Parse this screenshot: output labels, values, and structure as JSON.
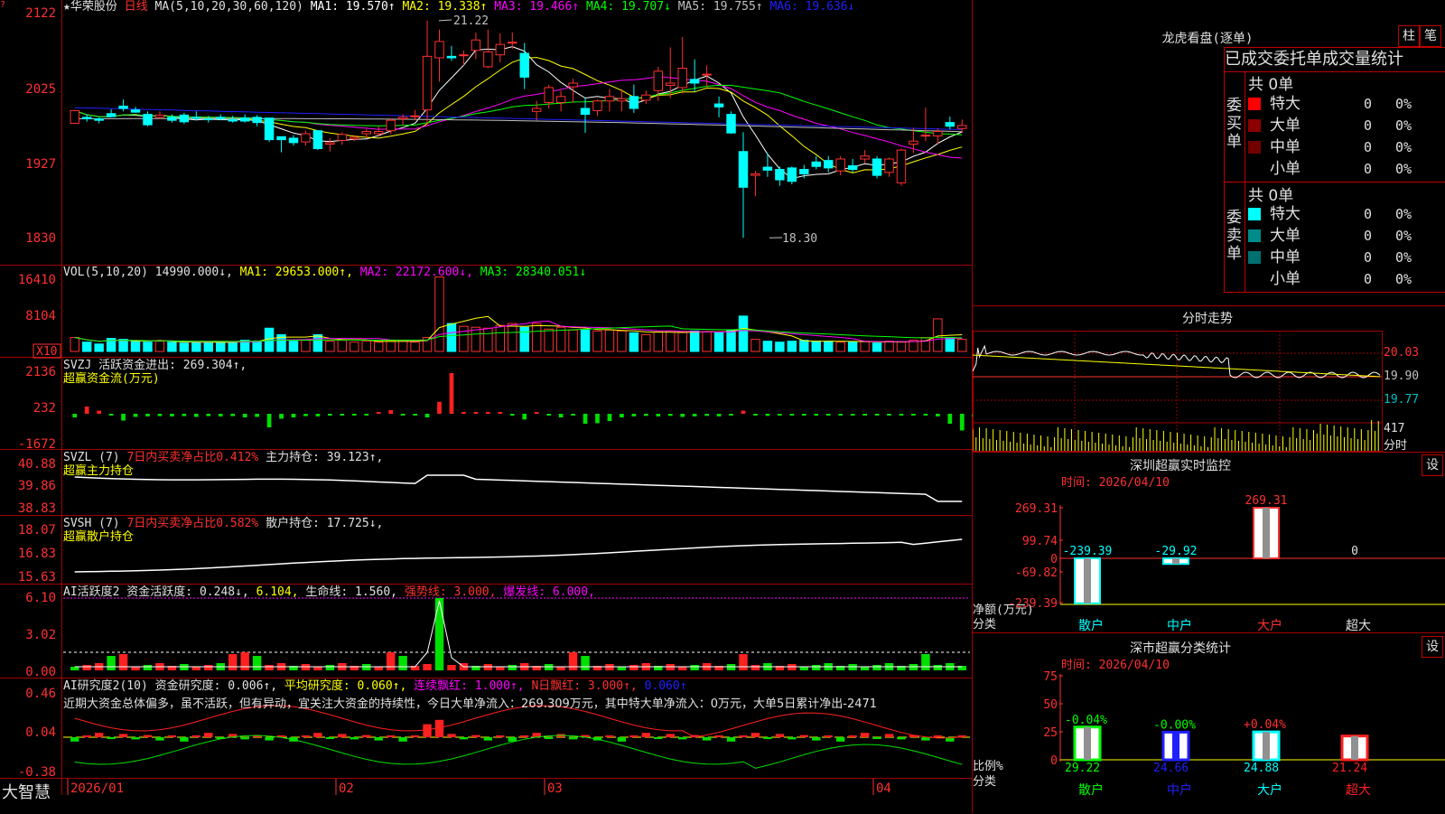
{
  "stock": {
    "name": "华荣股份",
    "period": "日线",
    "star": "★"
  },
  "kline_header": {
    "ma_label": "MA(5,10,20,30,60,120)",
    "ma1": "MA1: 19.570↑",
    "ma2": "MA2: 19.338↑",
    "ma3": "MA3: 19.466↑",
    "ma4": "MA4: 19.707↓",
    "ma5": "MA5: 19.755↑",
    "ma6": "MA6: 19.636↓"
  },
  "vol_header": {
    "label": "VOL(5,10,20)",
    "value": "14990.000↓,",
    "ma1": "MA1: 29653.000↑,",
    "ma2": "MA2: 22172.600↓,",
    "ma3": "MA3: 28340.051↓"
  },
  "svzj_header": {
    "label": "SVZJ  活跃资金进出: 269.304↑,",
    "sub": "超赢资金流(万元)"
  },
  "svzl_header": {
    "label": "SVZL (7)",
    "net": "7日内买卖净占比0.412%",
    "hold": "主力持仓: 39.123↑,",
    "sub": "超赢主力持仓"
  },
  "svsh_header": {
    "label": "SVSH (7)",
    "net": "7日内买卖净占比0.582%",
    "hold": "散户持仓: 17.725↓,",
    "sub": "超赢散户持仓"
  },
  "ai1_header": {
    "label": "AI活跃度2 资金活跃度: 0.248↓,",
    "v2": "6.104,",
    "life": "生命线: 1.560,",
    "strong": "强势线: 3.000,",
    "burst": "爆发线: 6.000,"
  },
  "ai2_header": {
    "label": "AI研究度2(10) 资金研究度: 0.006↑,",
    "avg": "平均研究度: 0.060↑,",
    "red": "连续飘红: 1.000↑,",
    "nred": "N日飘红: 3.000↑,",
    "last": "0.060↑",
    "comment": "近期大资金总体偏多，虽不活跃，但有异动，宜关注大资金的持续性，今日大单净流入：269.309万元，其中特大单净流入：0万元，大单5日累计净出-2471"
  },
  "axes": {
    "price": [
      "2122",
      "2025",
      "1927",
      "1830"
    ],
    "vol": [
      "16410",
      "8104",
      "X10"
    ],
    "svzj": [
      "2136",
      "232",
      "-1672"
    ],
    "svzl": [
      "40.88",
      "39.86",
      "38.83"
    ],
    "svsh": [
      "18.07",
      "16.83",
      "15.63"
    ],
    "ai1": [
      "6.10",
      "3.02",
      "0.00"
    ],
    "ai2": [
      "0.46",
      "0.04",
      "-0.38"
    ],
    "dates": [
      "2026/01",
      "02",
      "03",
      "04"
    ]
  },
  "price_annotations": {
    "high": "21.22",
    "low": "18.30"
  },
  "footer": {
    "brand": "大智慧"
  },
  "dragon_tiger": {
    "title": "龙虎看盘(逐单)",
    "btn1": "柱",
    "btn2": "笔",
    "tabs": "已成交委托单成交量统计",
    "buy_side": "委买单",
    "sell_side": "委卖单",
    "buy_total": "共 0单",
    "sell_total": "共 0单",
    "buy_rows": [
      {
        "label": "特大",
        "count": "0",
        "pct": "0%",
        "color": "#ff0000"
      },
      {
        "label": "大单",
        "count": "0",
        "pct": "0%",
        "color": "#8b0000"
      },
      {
        "label": "中单",
        "count": "0",
        "pct": "0%",
        "color": "#700000"
      },
      {
        "label": "小单",
        "count": "0",
        "pct": "0%",
        "color": "#000000"
      }
    ],
    "sell_rows": [
      {
        "label": "特大",
        "count": "0",
        "pct": "0%",
        "color": "#00ffff"
      },
      {
        "label": "大单",
        "count": "0",
        "pct": "0%",
        "color": "#008b8b"
      },
      {
        "label": "中单",
        "count": "0",
        "pct": "0%",
        "color": "#006f6f"
      },
      {
        "label": "小单",
        "count": "0",
        "pct": "0%",
        "color": "#000000"
      }
    ]
  },
  "intraday": {
    "title": "分时走势",
    "prices": [
      "20.03",
      "19.90",
      "19.77"
    ],
    "vol": "417",
    "vol_unit": "分时"
  },
  "monitor": {
    "title": "深圳超赢实时监控",
    "btn": "设",
    "time": "时间: 2026/04/10",
    "yticks": [
      "269.31",
      "99.74",
      "0",
      "-69.82",
      "-239.39"
    ],
    "ylabel": "净额(万元)",
    "xlabel": "分类",
    "categories": [
      "散户",
      "中户",
      "大户",
      "超大"
    ],
    "values": [
      -239.39,
      -29.92,
      269.31,
      0
    ],
    "value_labels": [
      "-239.39",
      "-29.92",
      "269.31",
      "0"
    ]
  },
  "classify": {
    "title": "深市超赢分类统计",
    "btn": "设",
    "time": "时间: 2026/04/10",
    "yticks": [
      "75",
      "50",
      "25",
      "0"
    ],
    "ylabel": "比例%",
    "xlabel": "分类",
    "categories": [
      "散户",
      "中户",
      "大户",
      "超大"
    ],
    "values": [
      29.22,
      24.66,
      24.88,
      21.24
    ],
    "changes": [
      "-0.04%",
      "-0.00%",
      "+0.04%",
      ""
    ]
  },
  "chart_data": {
    "type": "candlestick",
    "xlabel": "",
    "ylabel": "",
    "price_ylim": [
      18.3,
      21.22
    ],
    "candles_ohlc": [
      [
        19.84,
        20.02,
        19.84,
        20.01
      ],
      [
        19.92,
        19.96,
        19.86,
        19.9
      ],
      [
        19.9,
        19.92,
        19.84,
        19.88
      ],
      [
        19.97,
        20.03,
        19.93,
        19.93
      ],
      [
        20.07,
        20.16,
        20.0,
        20.04
      ],
      [
        20.02,
        20.06,
        19.98,
        19.99
      ],
      [
        19.96,
        20.0,
        19.8,
        19.82
      ],
      [
        19.92,
        20.0,
        19.9,
        19.95
      ],
      [
        19.92,
        19.96,
        19.85,
        19.88
      ],
      [
        19.95,
        19.98,
        19.83,
        19.86
      ],
      [
        19.92,
        20.0,
        19.88,
        19.91
      ],
      [
        19.9,
        19.94,
        19.85,
        19.89
      ],
      [
        19.92,
        19.96,
        19.88,
        19.9
      ],
      [
        19.89,
        19.94,
        19.85,
        19.87
      ],
      [
        19.91,
        19.96,
        19.85,
        19.87
      ],
      [
        19.92,
        19.95,
        19.8,
        19.85
      ],
      [
        19.91,
        19.91,
        19.59,
        19.62
      ],
      [
        19.66,
        19.66,
        19.45,
        19.62
      ],
      [
        19.64,
        19.68,
        19.54,
        19.58
      ],
      [
        19.59,
        19.74,
        19.54,
        19.7
      ],
      [
        19.74,
        19.75,
        19.48,
        19.5
      ],
      [
        19.56,
        19.64,
        19.46,
        19.58
      ],
      [
        19.61,
        19.72,
        19.55,
        19.69
      ],
      [
        19.63,
        19.68,
        19.6,
        19.65
      ],
      [
        19.7,
        19.76,
        19.64,
        19.73
      ],
      [
        19.7,
        19.8,
        19.66,
        19.73
      ],
      [
        19.74,
        19.9,
        19.7,
        19.88
      ],
      [
        19.9,
        19.96,
        19.82,
        19.92
      ],
      [
        19.93,
        20.02,
        19.88,
        19.94
      ],
      [
        20.02,
        21.22,
        19.82,
        20.74
      ],
      [
        20.72,
        21.1,
        20.4,
        20.94
      ],
      [
        20.74,
        20.88,
        20.68,
        20.72
      ],
      [
        20.75,
        20.82,
        20.62,
        20.76
      ],
      [
        20.82,
        21.06,
        20.7,
        20.96
      ],
      [
        20.6,
        21.1,
        20.58,
        20.8
      ],
      [
        20.76,
        21.05,
        20.66,
        20.9
      ],
      [
        20.93,
        21.06,
        20.84,
        20.93
      ],
      [
        20.78,
        20.92,
        20.3,
        20.46
      ],
      [
        20.0,
        20.14,
        19.88,
        20.04
      ],
      [
        20.12,
        20.36,
        20.04,
        20.32
      ],
      [
        20.12,
        20.28,
        20.0,
        20.2
      ],
      [
        20.33,
        20.44,
        20.12,
        20.38
      ],
      [
        20.04,
        20.18,
        19.71,
        19.96
      ],
      [
        20.01,
        20.16,
        19.94,
        20.14
      ],
      [
        20.14,
        20.3,
        20.0,
        20.2
      ],
      [
        20.14,
        20.3,
        20.0,
        20.17
      ],
      [
        20.2,
        20.36,
        19.98,
        20.04
      ],
      [
        20.15,
        20.28,
        20.1,
        20.22
      ],
      [
        20.28,
        20.6,
        20.14,
        20.54
      ],
      [
        20.35,
        20.86,
        20.18,
        20.38
      ],
      [
        20.32,
        21.0,
        20.24,
        20.58
      ],
      [
        20.43,
        20.7,
        20.26,
        20.38
      ],
      [
        20.5,
        20.62,
        20.34,
        20.5
      ],
      [
        20.1,
        20.2,
        19.92,
        20.06
      ],
      [
        19.96,
        20.0,
        19.7,
        19.71
      ],
      [
        19.46,
        19.72,
        18.3,
        18.98
      ],
      [
        19.14,
        19.2,
        18.86,
        19.16
      ],
      [
        19.25,
        19.44,
        19.12,
        19.21
      ],
      [
        19.22,
        19.26,
        19.0,
        19.08
      ],
      [
        19.24,
        19.26,
        19.02,
        19.06
      ],
      [
        19.22,
        19.28,
        19.1,
        19.16
      ],
      [
        19.32,
        19.4,
        19.22,
        19.26
      ],
      [
        19.34,
        19.4,
        19.18,
        19.24
      ],
      [
        19.2,
        19.4,
        19.14,
        19.36
      ],
      [
        19.27,
        19.36,
        19.18,
        19.22
      ],
      [
        19.36,
        19.48,
        19.3,
        19.4
      ],
      [
        19.36,
        19.4,
        19.1,
        19.14
      ],
      [
        19.18,
        19.38,
        19.12,
        19.36
      ],
      [
        19.04,
        19.5,
        19.0,
        19.48
      ],
      [
        19.56,
        19.78,
        19.44,
        19.6
      ],
      [
        19.68,
        20.05,
        19.6,
        19.68
      ],
      [
        19.67,
        19.77,
        19.56,
        19.73
      ],
      [
        19.85,
        19.93,
        19.76,
        19.8
      ],
      [
        19.77,
        19.89,
        19.71,
        19.81
      ]
    ],
    "volume": [
      30,
      20,
      16,
      28,
      26,
      22,
      20,
      22,
      20,
      18,
      20,
      20,
      20,
      20,
      24,
      22,
      50,
      36,
      22,
      24,
      36,
      22,
      24,
      20,
      22,
      20,
      22,
      24,
      20,
      30,
      160,
      60,
      54,
      52,
      50,
      56,
      60,
      52,
      60,
      48,
      52,
      46,
      46,
      44,
      46,
      44,
      40,
      36,
      42,
      44,
      42,
      44,
      42,
      40,
      46,
      76,
      26,
      22,
      20,
      22,
      24,
      22,
      22,
      20,
      20,
      22,
      18,
      22,
      20,
      24,
      30,
      70,
      30,
      26
    ],
    "svzj": [
      -140,
      280,
      120,
      -40,
      -260,
      -120,
      -100,
      -90,
      -100,
      -90,
      -120,
      -90,
      -100,
      -90,
      -140,
      -120,
      -520,
      -190,
      -140,
      -90,
      -100,
      -40,
      -40,
      -40,
      -40,
      40,
      140,
      -40,
      -40,
      -140,
      460,
      1560,
      40,
      40,
      40,
      40,
      -40,
      -220,
      40,
      -60,
      -140,
      -40,
      -380,
      -360,
      -280,
      -140,
      -100,
      -80,
      -100,
      -80,
      -120,
      -100,
      -80,
      -100,
      -60,
      120,
      -40,
      -80,
      -40,
      -40,
      -40,
      -40,
      -40,
      -40,
      -40,
      -40,
      -40,
      -40,
      -40,
      -40,
      -40,
      -100,
      -380,
      -640,
      -120,
      160
    ]
  }
}
